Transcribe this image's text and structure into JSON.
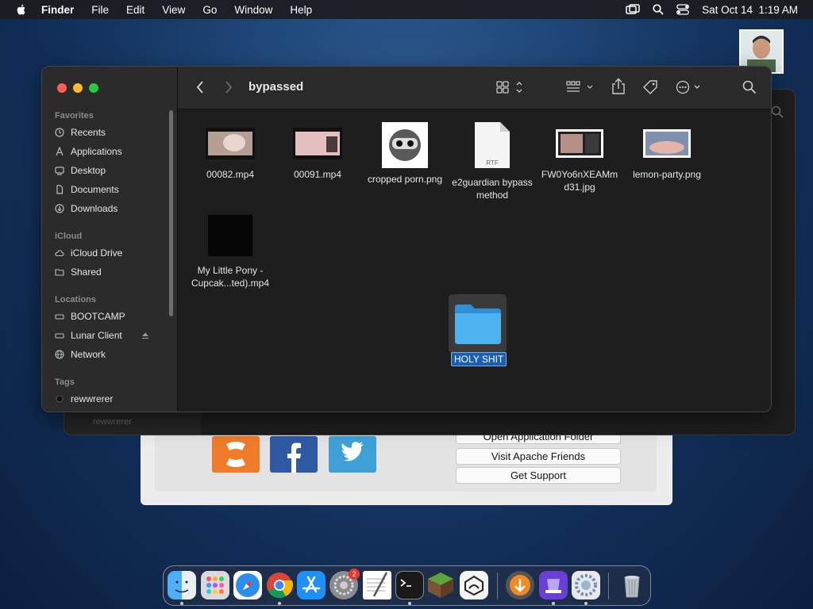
{
  "menubar": {
    "app_name": "Finder",
    "menus": [
      "File",
      "Edit",
      "View",
      "Go",
      "Window",
      "Help"
    ],
    "clock": "Sat Oct 14  1:19 AM"
  },
  "finder": {
    "title": "bypassed",
    "sidebar": {
      "favorites_header": "Favorites",
      "favorites": [
        "Recents",
        "Applications",
        "Desktop",
        "Documents",
        "Downloads"
      ],
      "icloud_header": "iCloud",
      "icloud": [
        "iCloud Drive",
        "Shared"
      ],
      "locations_header": "Locations",
      "locations": [
        "BOOTCAMP",
        "Lunar Client",
        "Network"
      ],
      "tags_header": "Tags",
      "tags": [
        "rewwrerer"
      ]
    },
    "files": [
      {
        "name": "00082.mp4"
      },
      {
        "name": "00091.mp4"
      },
      {
        "name": "cropped porn.png"
      },
      {
        "name": "e2guardian bypass method",
        "badge": "RTF"
      },
      {
        "name": "FW0Yo6nXEAMmd31.jpg"
      },
      {
        "name": "lemon-party.png"
      },
      {
        "name": "My Little Pony - Cupcak...ted).mp4"
      }
    ],
    "selected_folder": "HOLY SHIT"
  },
  "xampp": {
    "buttons": [
      "Open Application Folder",
      "Visit Apache Friends",
      "Get Support"
    ]
  },
  "back_window": {
    "sidebar_tag": "rewwrerer"
  },
  "dock": {
    "settings_badge": "2",
    "apps": [
      "finder-icon",
      "launchpad-icon",
      "safari-icon",
      "chrome-icon",
      "app-store-icon",
      "system-settings-icon",
      "textedit-icon",
      "terminal-icon",
      "minecraft-icon",
      "lunar-client-icon",
      "downloads-stack-icon",
      "xampp-icon",
      "system-prefs-icon",
      "trash-icon"
    ]
  },
  "colors": {
    "accent": "#1a5fb4",
    "folder": "#3aa8f0",
    "traffic_red": "#ff5f57",
    "traffic_yellow": "#febc2e",
    "traffic_green": "#28c840"
  }
}
